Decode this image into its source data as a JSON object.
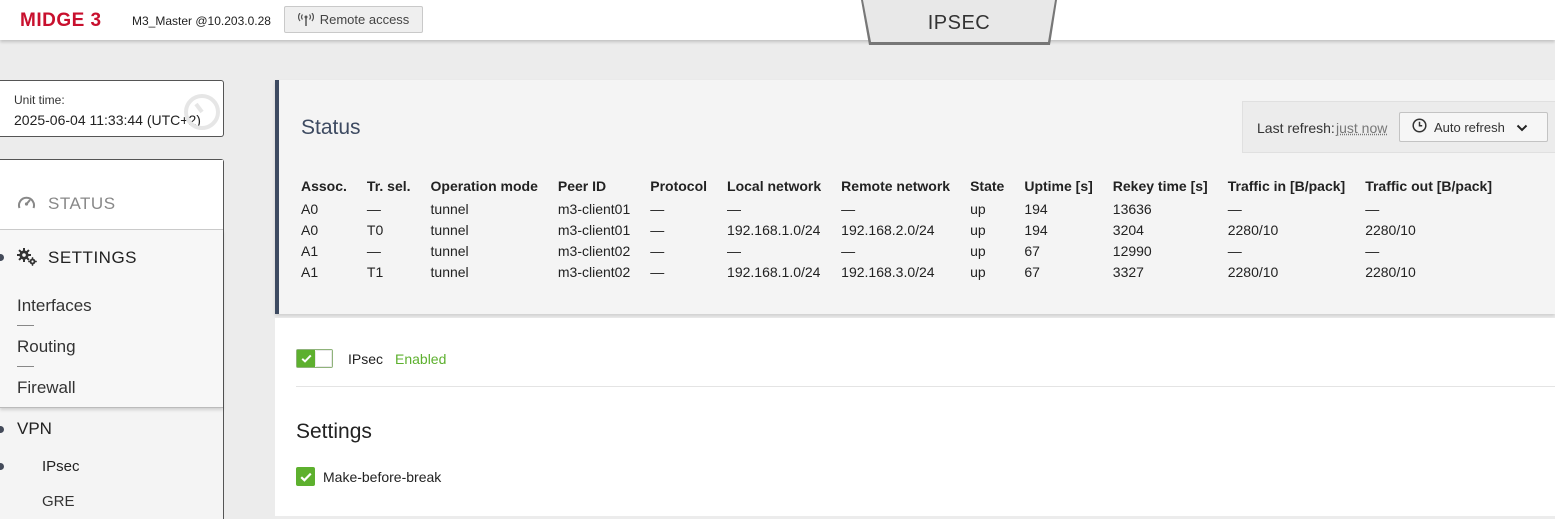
{
  "header": {
    "logo": "MIDGE 3",
    "device": "M3_Master @10.203.0.28",
    "remote_access_label": "Remote access",
    "page_title": "IPSEC"
  },
  "sidebar": {
    "unit_time_label": "Unit time:",
    "unit_time_value": "2025-06-04 11:33:44 (UTC+2)",
    "status_label": "STATUS",
    "settings_label": "SETTINGS",
    "settings_items": [
      "Interfaces",
      "Routing",
      "Firewall"
    ],
    "vpn_label": "VPN",
    "vpn_items": [
      "IPsec",
      "GRE"
    ]
  },
  "status": {
    "title": "Status",
    "last_refresh_label": "Last refresh:",
    "last_refresh_value": "just now",
    "auto_refresh_label": "Auto refresh",
    "columns": [
      "Assoc.",
      "Tr. sel.",
      "Operation mode",
      "Peer ID",
      "Protocol",
      "Local network",
      "Remote network",
      "State",
      "Uptime [s]",
      "Rekey time [s]",
      "Traffic in [B/pack]",
      "Traffic out [B/pack]"
    ],
    "rows": [
      [
        "A0",
        "—",
        "tunnel",
        "m3-client01",
        "—",
        "—",
        "—",
        "up",
        "194",
        "13636",
        "—",
        "—"
      ],
      [
        "A0",
        "T0",
        "tunnel",
        "m3-client01",
        "—",
        "192.168.1.0/24",
        "192.168.2.0/24",
        "up",
        "194",
        "3204",
        "2280/10",
        "2280/10"
      ],
      [
        "A1",
        "—",
        "tunnel",
        "m3-client02",
        "—",
        "—",
        "—",
        "up",
        "67",
        "12990",
        "—",
        "—"
      ],
      [
        "A1",
        "T1",
        "tunnel",
        "m3-client02",
        "—",
        "192.168.1.0/24",
        "192.168.3.0/24",
        "up",
        "67",
        "3327",
        "2280/10",
        "2280/10"
      ]
    ]
  },
  "ipsec": {
    "toggle_label": "IPsec",
    "toggle_state": "Enabled",
    "toggle_on": true
  },
  "settings": {
    "title": "Settings",
    "make_before_break_label": "Make-before-break",
    "make_before_break_checked": true
  },
  "colors": {
    "brand": "#c8102e",
    "accent_navy": "#3d4a61",
    "enabled_green": "#5db02e"
  }
}
